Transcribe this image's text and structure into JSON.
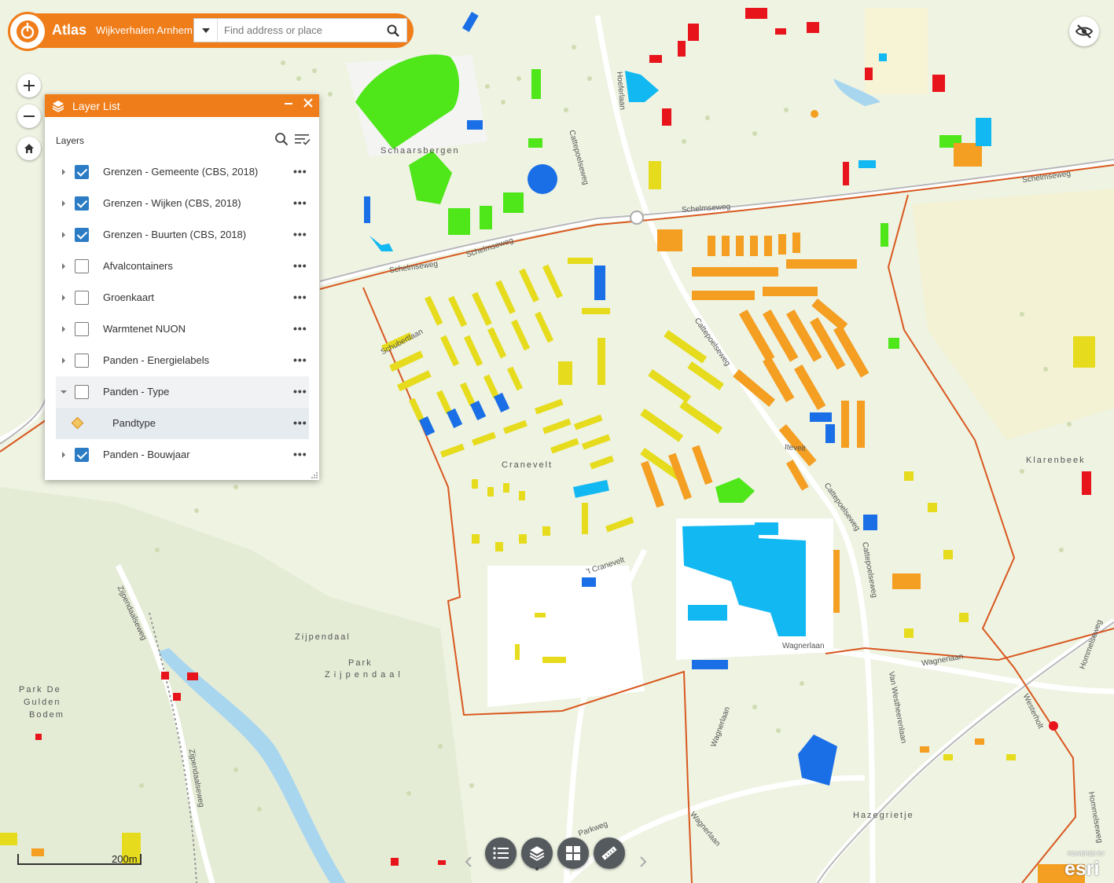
{
  "app": {
    "title": "Atlas",
    "subtitle": "Wijkverhalen Arnhem",
    "search_placeholder": "Find address or place"
  },
  "layer_panel": {
    "title": "Layer List",
    "section_label": "Layers",
    "layers": [
      {
        "label": "Grenzen - Gemeente (CBS, 2018)",
        "checked": true
      },
      {
        "label": "Grenzen - Wijken (CBS, 2018)",
        "checked": true
      },
      {
        "label": "Grenzen - Buurten (CBS, 2018)",
        "checked": true
      },
      {
        "label": "Afvalcontainers",
        "checked": false
      },
      {
        "label": "Groenkaart",
        "checked": false
      },
      {
        "label": "Warmtenet NUON",
        "checked": false
      },
      {
        "label": "Panden - Energielabels",
        "checked": false
      },
      {
        "label": "Panden - Type",
        "checked": false,
        "expanded": true
      },
      {
        "label": "Pandtype",
        "sublayer": true
      },
      {
        "label": "Panden - Bouwjaar",
        "checked": true
      }
    ]
  },
  "map": {
    "scale_label": "200m",
    "place_labels": [
      "Schaarsbergen",
      "Cranevelt",
      "Zijpendaal",
      "Park",
      "Zijpendaal",
      "Park De",
      "Gulden",
      "Bodem",
      "Klarenbeek",
      "Hazegrietje"
    ],
    "street_labels": [
      "Schelmseweg",
      "Schelmseweg",
      "Schelmseweg",
      "Schelmseweg",
      "Cattepoelseweg",
      "Cattepoelseweg",
      "Cattepoelseweg",
      "Cattepoelseweg",
      "Hoeferlaan",
      "Schubertlaan",
      "'t Cranevelt",
      "Wagnerlaan",
      "Wagnerlaan",
      "Wagnerlaan",
      "Zijpendaalseweg",
      "Zijpendaalseweg",
      "Van Westheerenlaan",
      "Hommelseweg",
      "Hommelseweg",
      "Parkweg",
      "Wagnerlaan",
      "Westerholt",
      "Itevelt"
    ],
    "attribution": "esri",
    "attribution_small": "POWERED BY"
  },
  "colors": {
    "accent": "#ef7d1a",
    "boundary": "#d9581f",
    "yellow": "#e6dc1d",
    "orange": "#f49e22",
    "red": "#e8141c",
    "blue": "#1a6fe6",
    "cyan": "#12b8f2",
    "green": "#4fe61a"
  }
}
